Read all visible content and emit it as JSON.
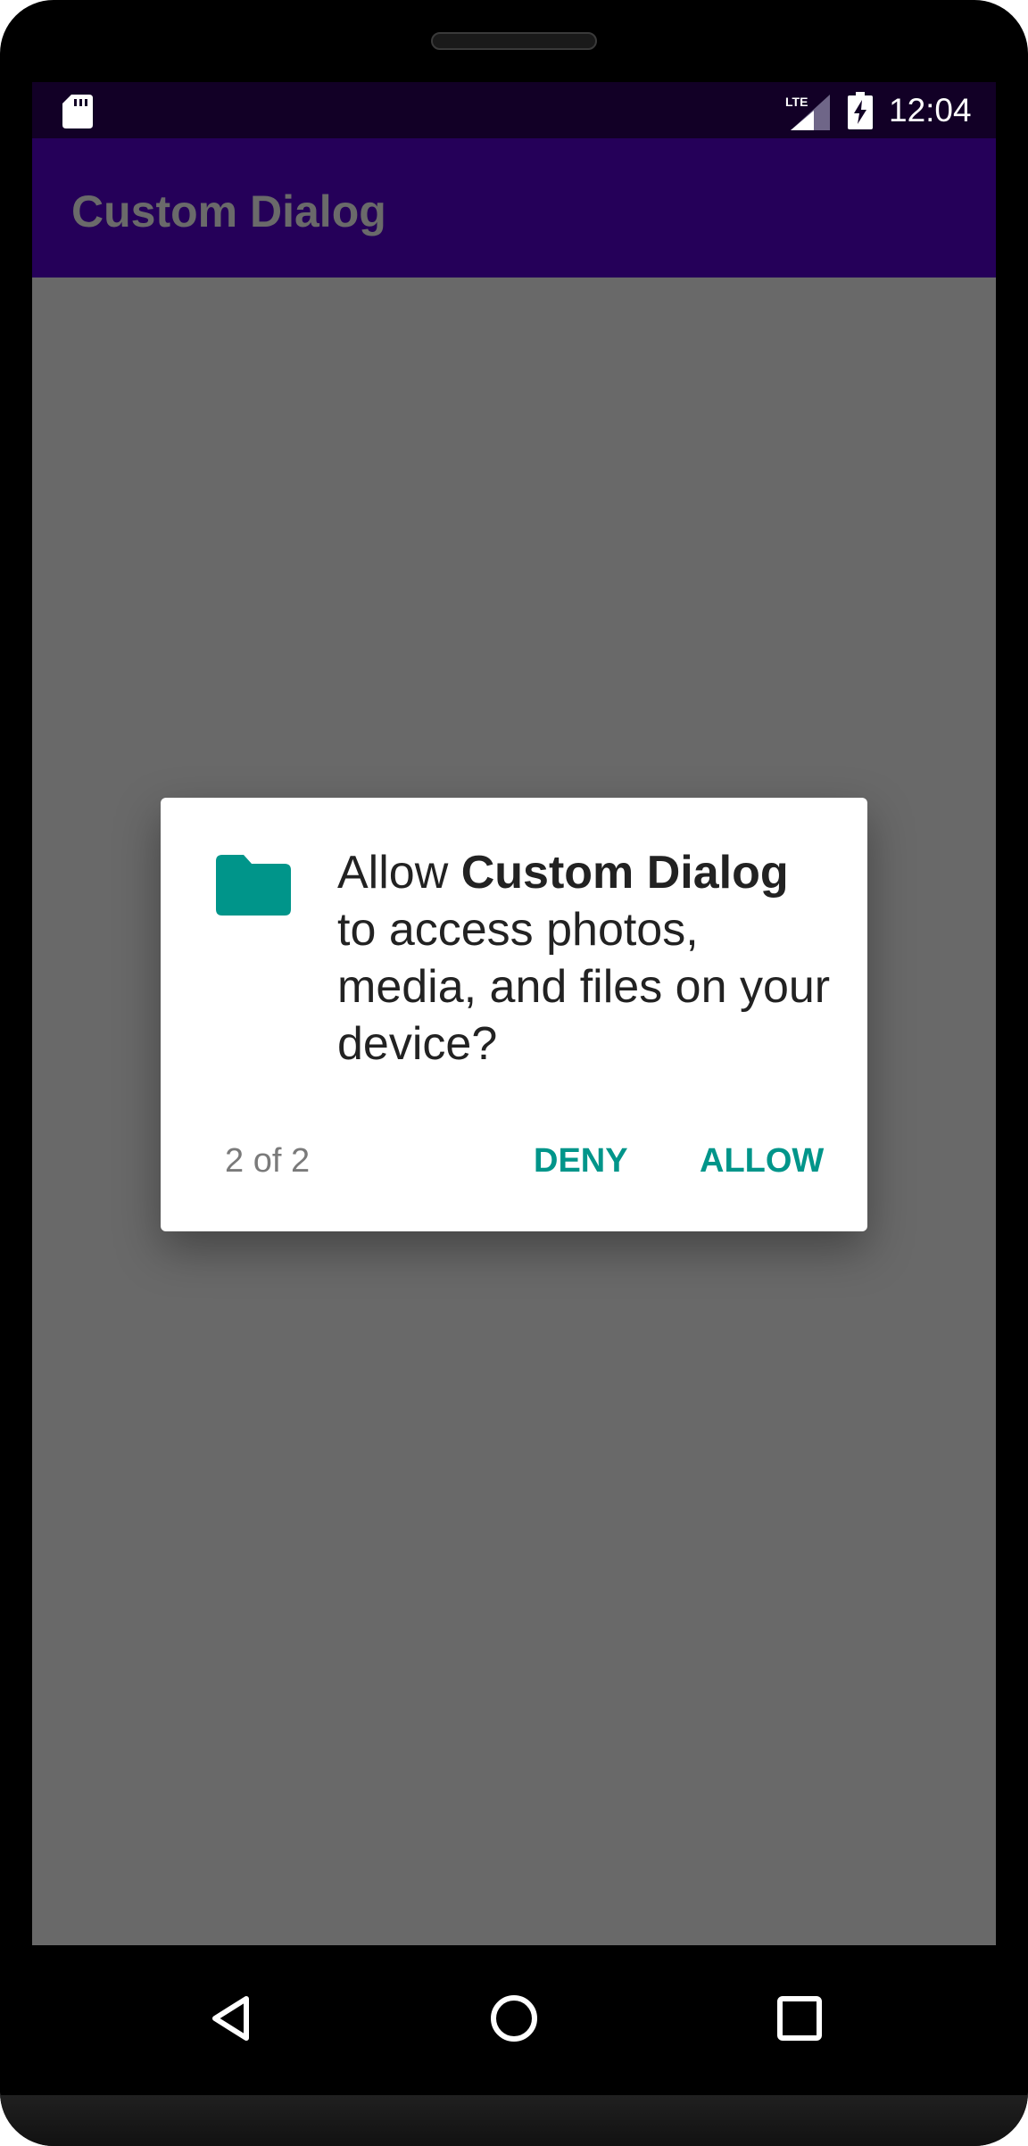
{
  "status_bar": {
    "time": "12:04",
    "network_label": "LTE",
    "icons": [
      "sd-card-icon",
      "lte-signal-icon",
      "battery-charging-icon"
    ]
  },
  "app_bar": {
    "title": "Custom Dialog"
  },
  "dialog": {
    "icon": "folder-icon",
    "message_prefix": "Allow ",
    "app_name": "Custom Dialog",
    "message_suffix": " to access photos, media, and files on your device?",
    "counter": "2 of 2",
    "deny_label": "DENY",
    "allow_label": "ALLOW"
  },
  "navigation": {
    "icons": [
      "back-icon",
      "home-icon",
      "recents-icon"
    ]
  },
  "colors": {
    "status_bar": "#120026",
    "app_bar": "#250059",
    "scrim_background": "#696969",
    "dialog_accent": "#00958a",
    "dialog_background": "#ffffff"
  }
}
